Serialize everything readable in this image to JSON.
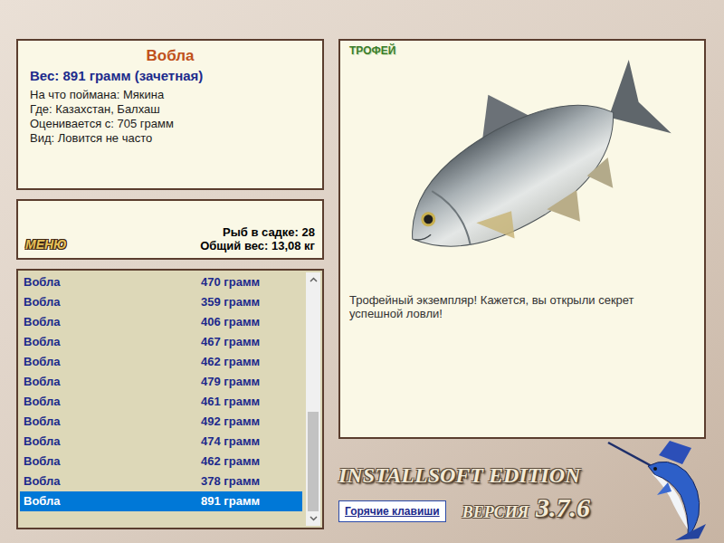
{
  "fish": {
    "name": "Вобла",
    "weight": "Вес: 891 грамм (зачетная)",
    "details": [
      "На что поймана: Мякина",
      "Где: Казахстан, Балхаш",
      "Оценивается с: 705 грамм",
      "Вид: Ловится не часто"
    ]
  },
  "menu": {
    "label": "МЕНЮ"
  },
  "keepnet": {
    "count": "Рыб в садке: 28",
    "total": "Общий вес: 13,08 кг"
  },
  "catch_list": {
    "rows": [
      {
        "name": "Вобла",
        "weight": "470 грамм",
        "selected": false
      },
      {
        "name": "Вобла",
        "weight": "359 грамм",
        "selected": false
      },
      {
        "name": "Вобла",
        "weight": "406 грамм",
        "selected": false
      },
      {
        "name": "Вобла",
        "weight": "467 грамм",
        "selected": false
      },
      {
        "name": "Вобла",
        "weight": "462 грамм",
        "selected": false
      },
      {
        "name": "Вобла",
        "weight": "479 грамм",
        "selected": false
      },
      {
        "name": "Вобла",
        "weight": "461 грамм",
        "selected": false
      },
      {
        "name": "Вобла",
        "weight": "492 грамм",
        "selected": false
      },
      {
        "name": "Вобла",
        "weight": "474 грамм",
        "selected": false
      },
      {
        "name": "Вобла",
        "weight": "462 грамм",
        "selected": false
      },
      {
        "name": "Вобла",
        "weight": "378 грамм",
        "selected": false
      },
      {
        "name": "Вобла",
        "weight": "891 грамм",
        "selected": true
      }
    ]
  },
  "trophy": {
    "badge": "ТРОФЕЙ",
    "message": "Трофейный экземпляр! Кажется, вы открыли секрет успешной ловли!"
  },
  "footer": {
    "edition": "INSTALLSOFT EDITION",
    "version_label": "ВЕРСИЯ",
    "version": "3.7.6",
    "hotkeys_button": "Горячие клавиши"
  }
}
